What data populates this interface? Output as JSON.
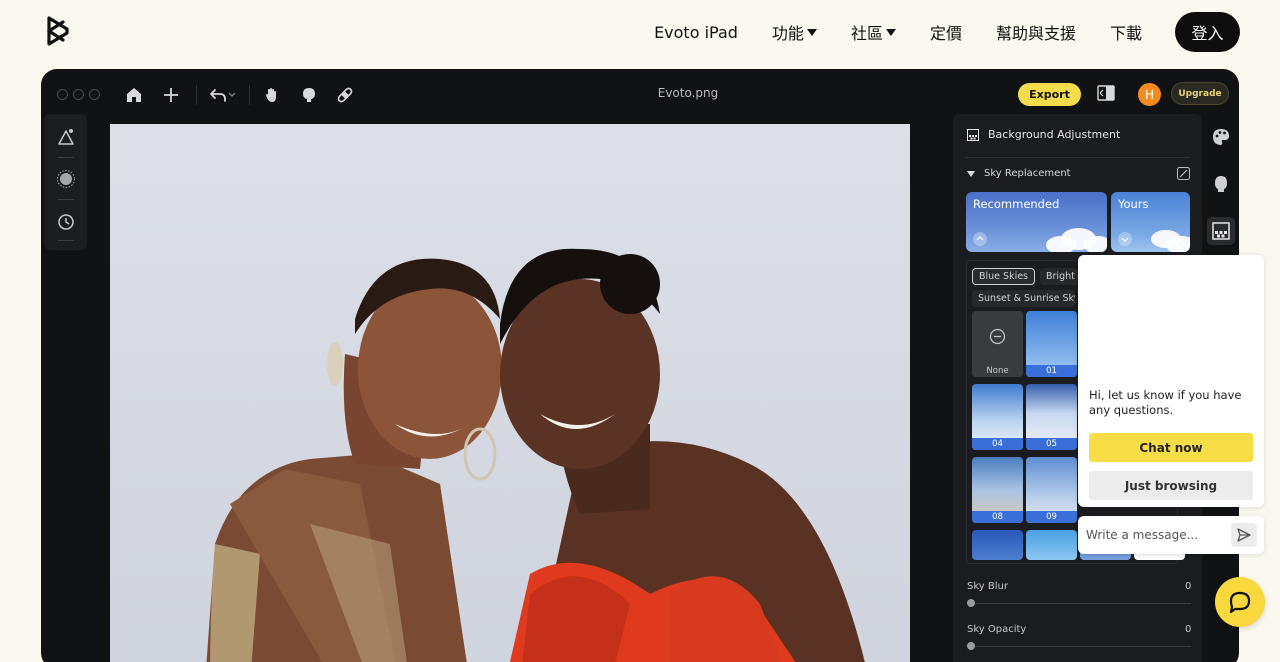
{
  "nav": {
    "logo_icon": "evoto-logo-icon",
    "links": [
      "Evoto iPad",
      "功能",
      "社區",
      "定價",
      "幫助與支援",
      "下載"
    ],
    "login": "登入"
  },
  "app": {
    "filename": "Evoto.png",
    "export_label": "Export",
    "avatar_letter": "H",
    "upgrade_label": "Upgrade",
    "accent_color": "#f5dc4a"
  },
  "panel": {
    "title": "Background Adjustment",
    "section": "Sky Replacement",
    "cards": [
      {
        "label": "Recommended"
      },
      {
        "label": "Yours"
      }
    ],
    "chips": [
      "Blue Skies",
      "Bright",
      "Sunset & Sunrise Sky"
    ],
    "thumbs": [
      "None",
      "01",
      "04",
      "05",
      "08",
      "09"
    ],
    "sliders": [
      {
        "label": "Sky Blur",
        "value": "0"
      },
      {
        "label": "Sky Opacity",
        "value": "0"
      }
    ]
  },
  "chat": {
    "message": "Hi, let us know if you have any questions.",
    "chat_now": "Chat now",
    "just_browsing": "Just browsing",
    "input_placeholder": "Write a message..."
  }
}
